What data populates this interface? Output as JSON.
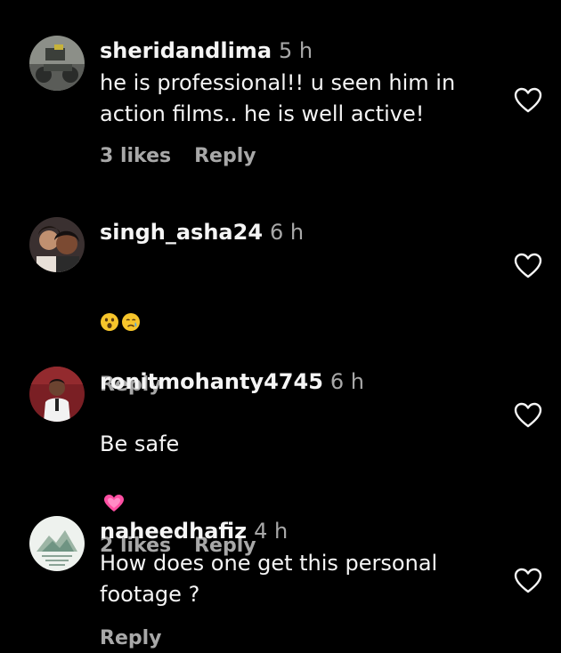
{
  "comments": [
    {
      "username": "sheridandlima",
      "time": "5 h",
      "text": "he is professional!! u seen him in\naction films.. he is well active!",
      "likes": "3 likes",
      "reply": "Reply"
    },
    {
      "username": "singh_asha24",
      "time": "6 h",
      "emojis": [
        "astonished-face",
        "crying-face"
      ],
      "reply": "Reply"
    },
    {
      "username": "ronitmohanty4745",
      "time": "6 h",
      "text": "Be safe",
      "emoji": "growing-heart",
      "likes": "2 likes",
      "reply": "Reply"
    },
    {
      "username": "naheedhafiz",
      "time": "4 h",
      "text": "How does one get this personal\nfootage ?",
      "reply": "Reply"
    }
  ],
  "icons": {
    "like": "heart-outline-icon"
  },
  "colors": {
    "background": "#000000",
    "primary_text": "#f5f5f5",
    "secondary_text": "#a8a8a8"
  }
}
